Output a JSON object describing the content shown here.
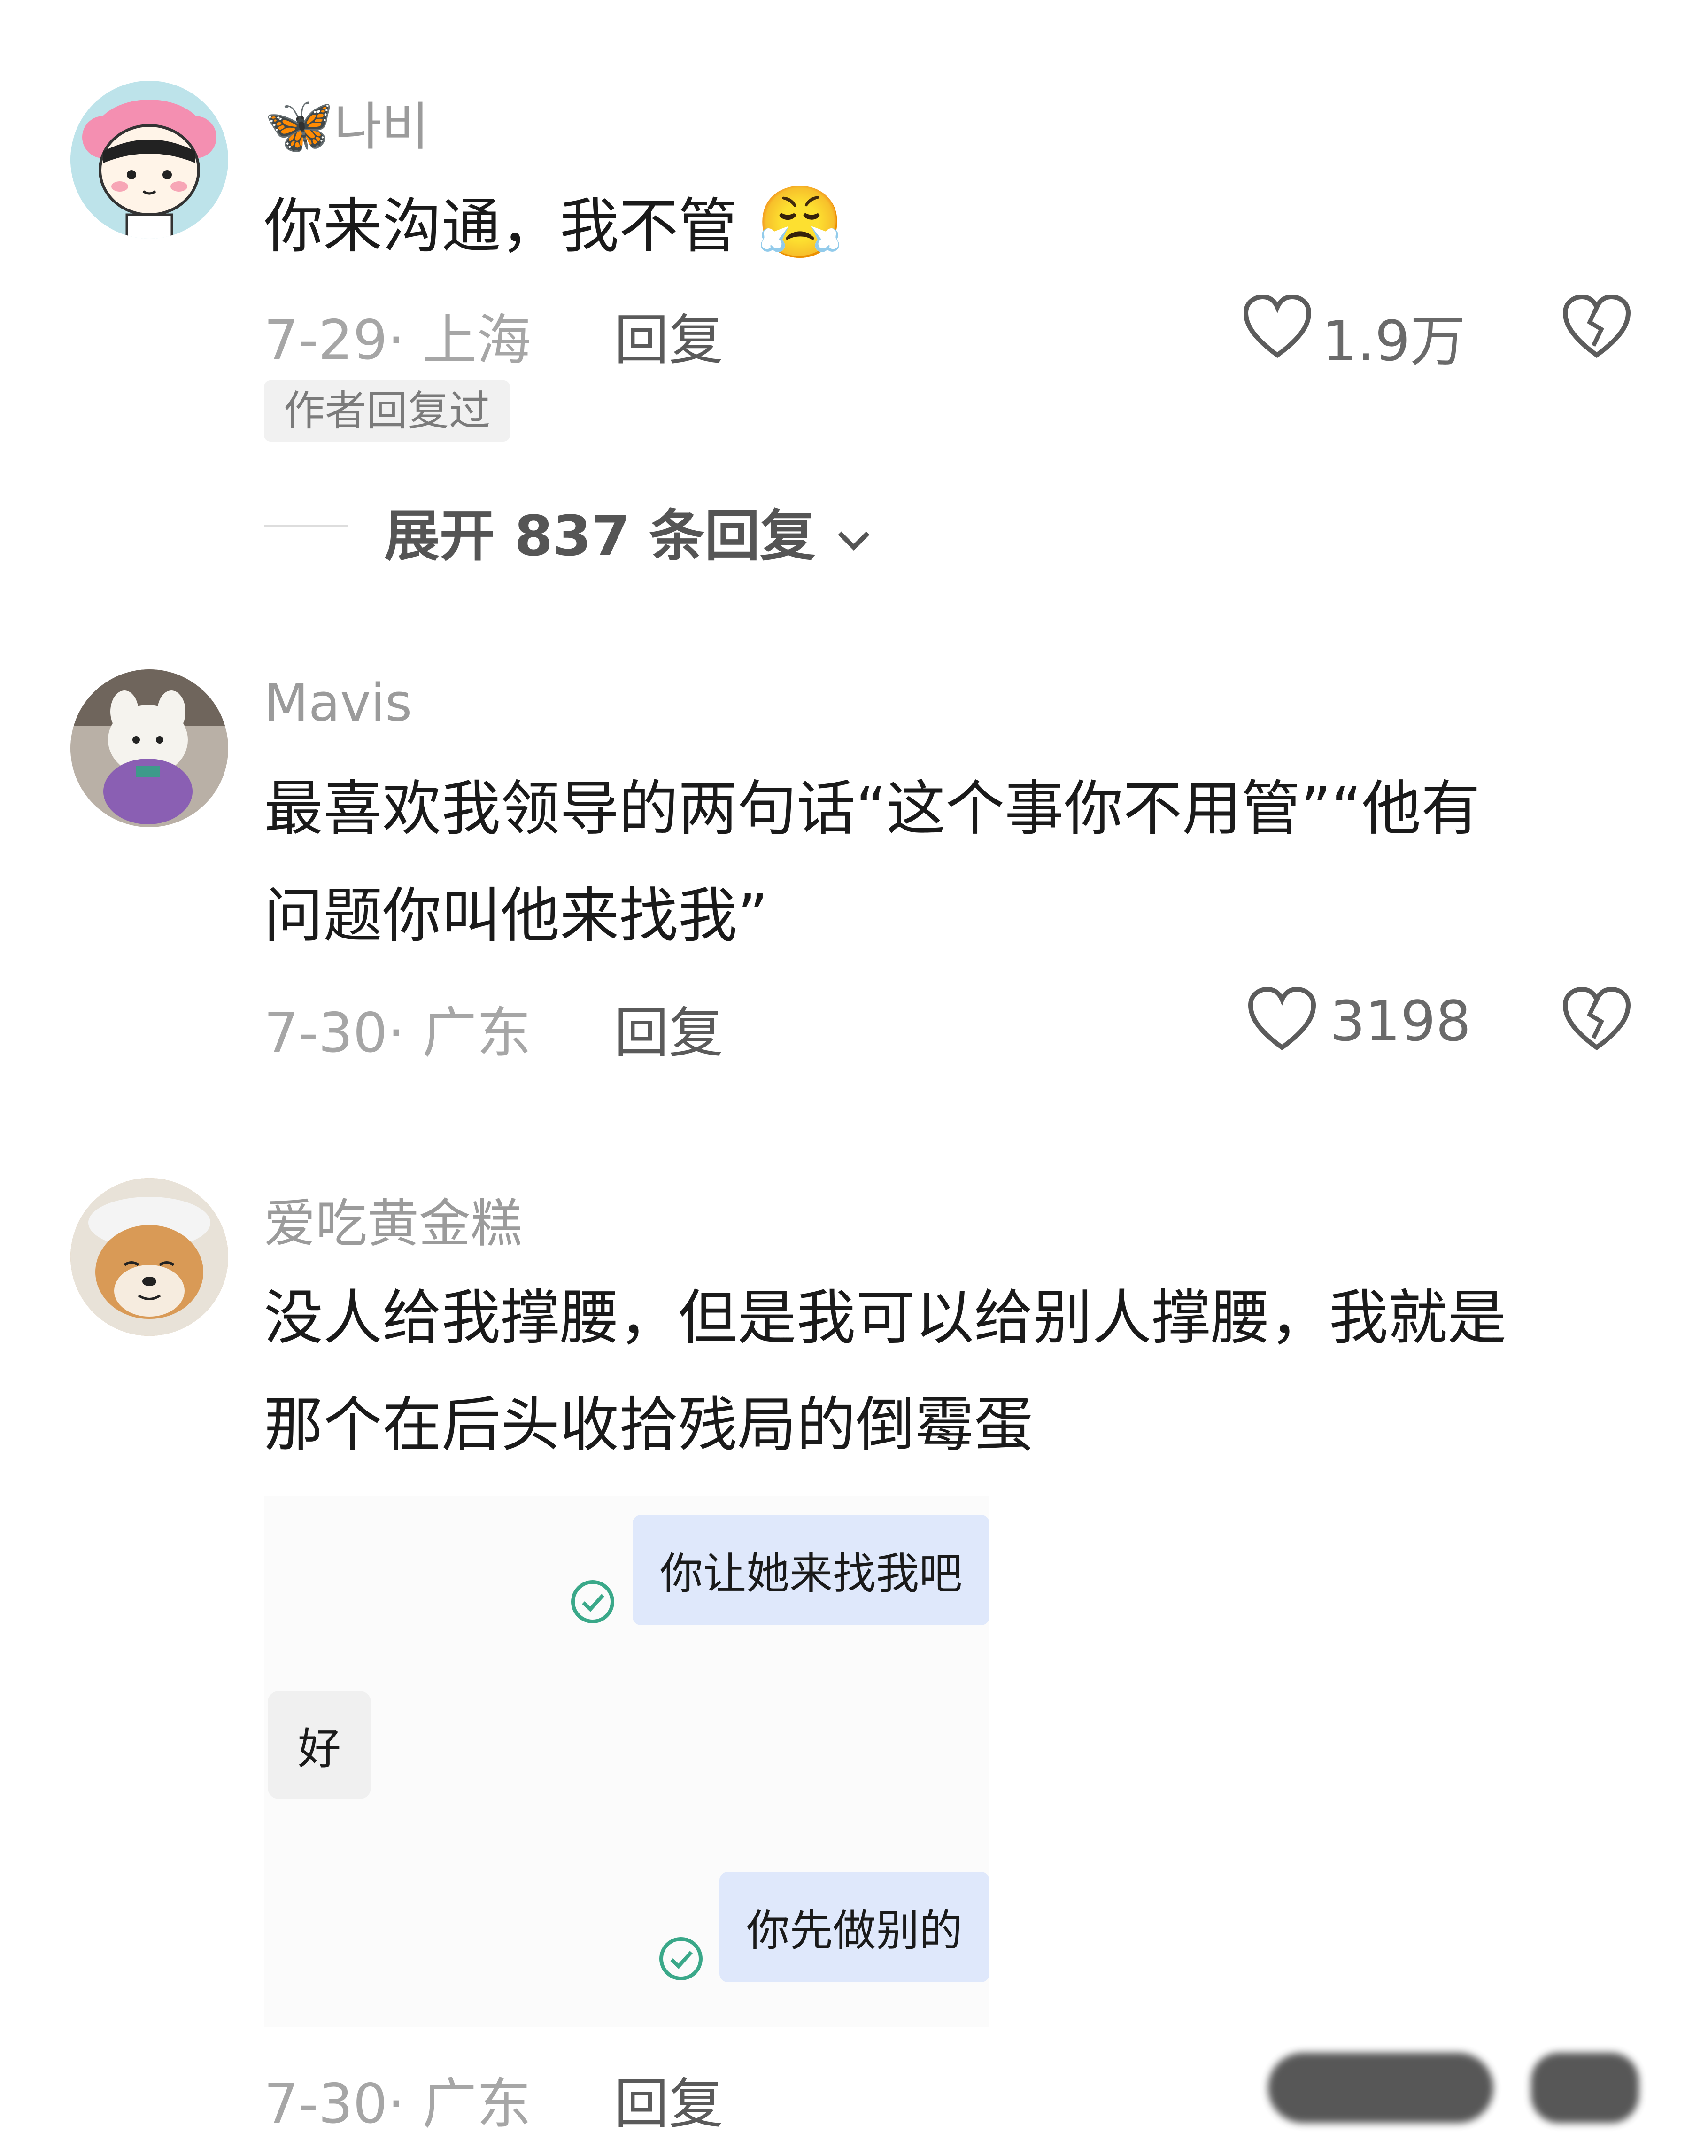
{
  "comments": [
    {
      "username": "나비",
      "username_emoji": "🦋",
      "text_lines": [
        "你来沟通，我不管"
      ],
      "inline_emoji": "😤",
      "date": "7-29",
      "location": "上海",
      "reply_label": "回复",
      "likes": "1.9万",
      "badge": "作者回复过",
      "expand_label": "展开 837 条回复"
    },
    {
      "username": "Mavis",
      "text_lines": [
        "最喜欢我领导的两句话“这个事你不用管”“他有",
        "问题你叫他来找我”"
      ],
      "date": "7-30",
      "location": "广东",
      "reply_label": "回复",
      "likes": "3198"
    },
    {
      "username": "爱吃黄金糕",
      "text_lines": [
        "没人给我撑腰，但是我可以给别人撑腰，我就是",
        "那个在后头收拾残局的倒霉蛋"
      ],
      "date": "7-30",
      "location": "广东",
      "reply_label": "回复",
      "chat_image": {
        "messages": [
          {
            "side": "right",
            "text": "你让她来找我吧",
            "read": true
          },
          {
            "side": "left",
            "text": "好"
          },
          {
            "side": "right",
            "text": "你先做别的",
            "read": true
          }
        ]
      }
    }
  ],
  "colors": {
    "accent_read": "#3aa889",
    "bubble_blue": "#dfe8fb",
    "heart_outline": "#5c5c5c"
  }
}
